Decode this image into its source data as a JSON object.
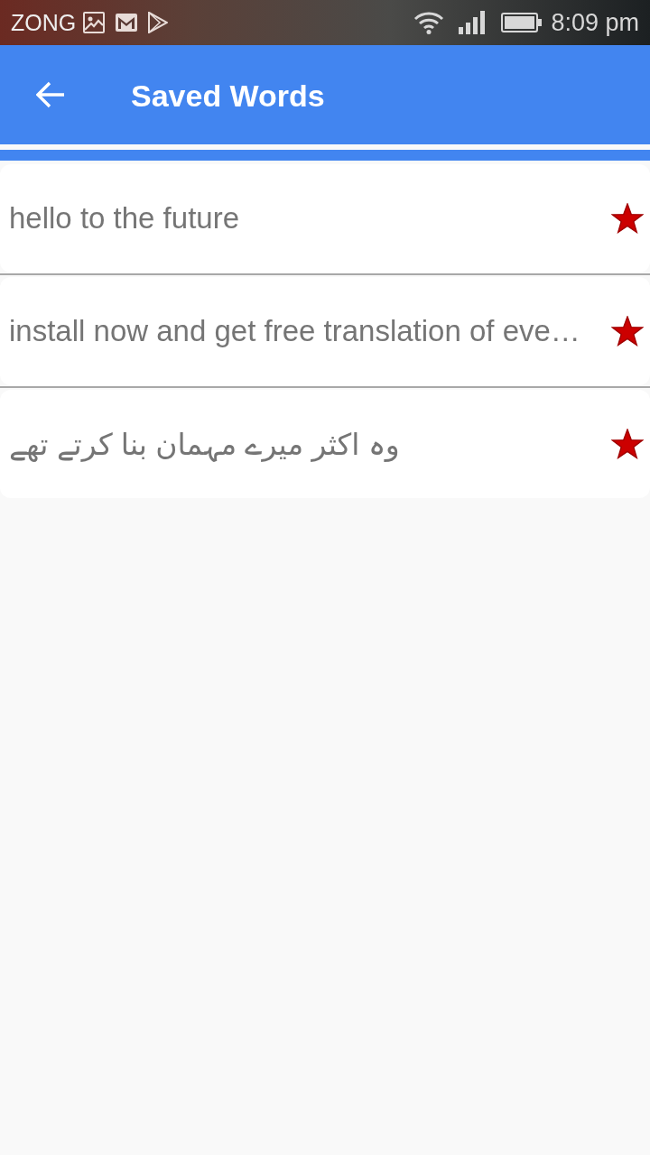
{
  "status_bar": {
    "carrier": "ZONG",
    "time": "8:09 pm"
  },
  "app_bar": {
    "title": "Saved Words"
  },
  "saved_words": [
    {
      "text": "hello to the future",
      "starred": true
    },
    {
      "text": "install now and get free translation of eve…",
      "starred": true
    },
    {
      "text": "وہ اکثر میرے مہمان بنا کرتے تھے",
      "starred": true
    }
  ]
}
